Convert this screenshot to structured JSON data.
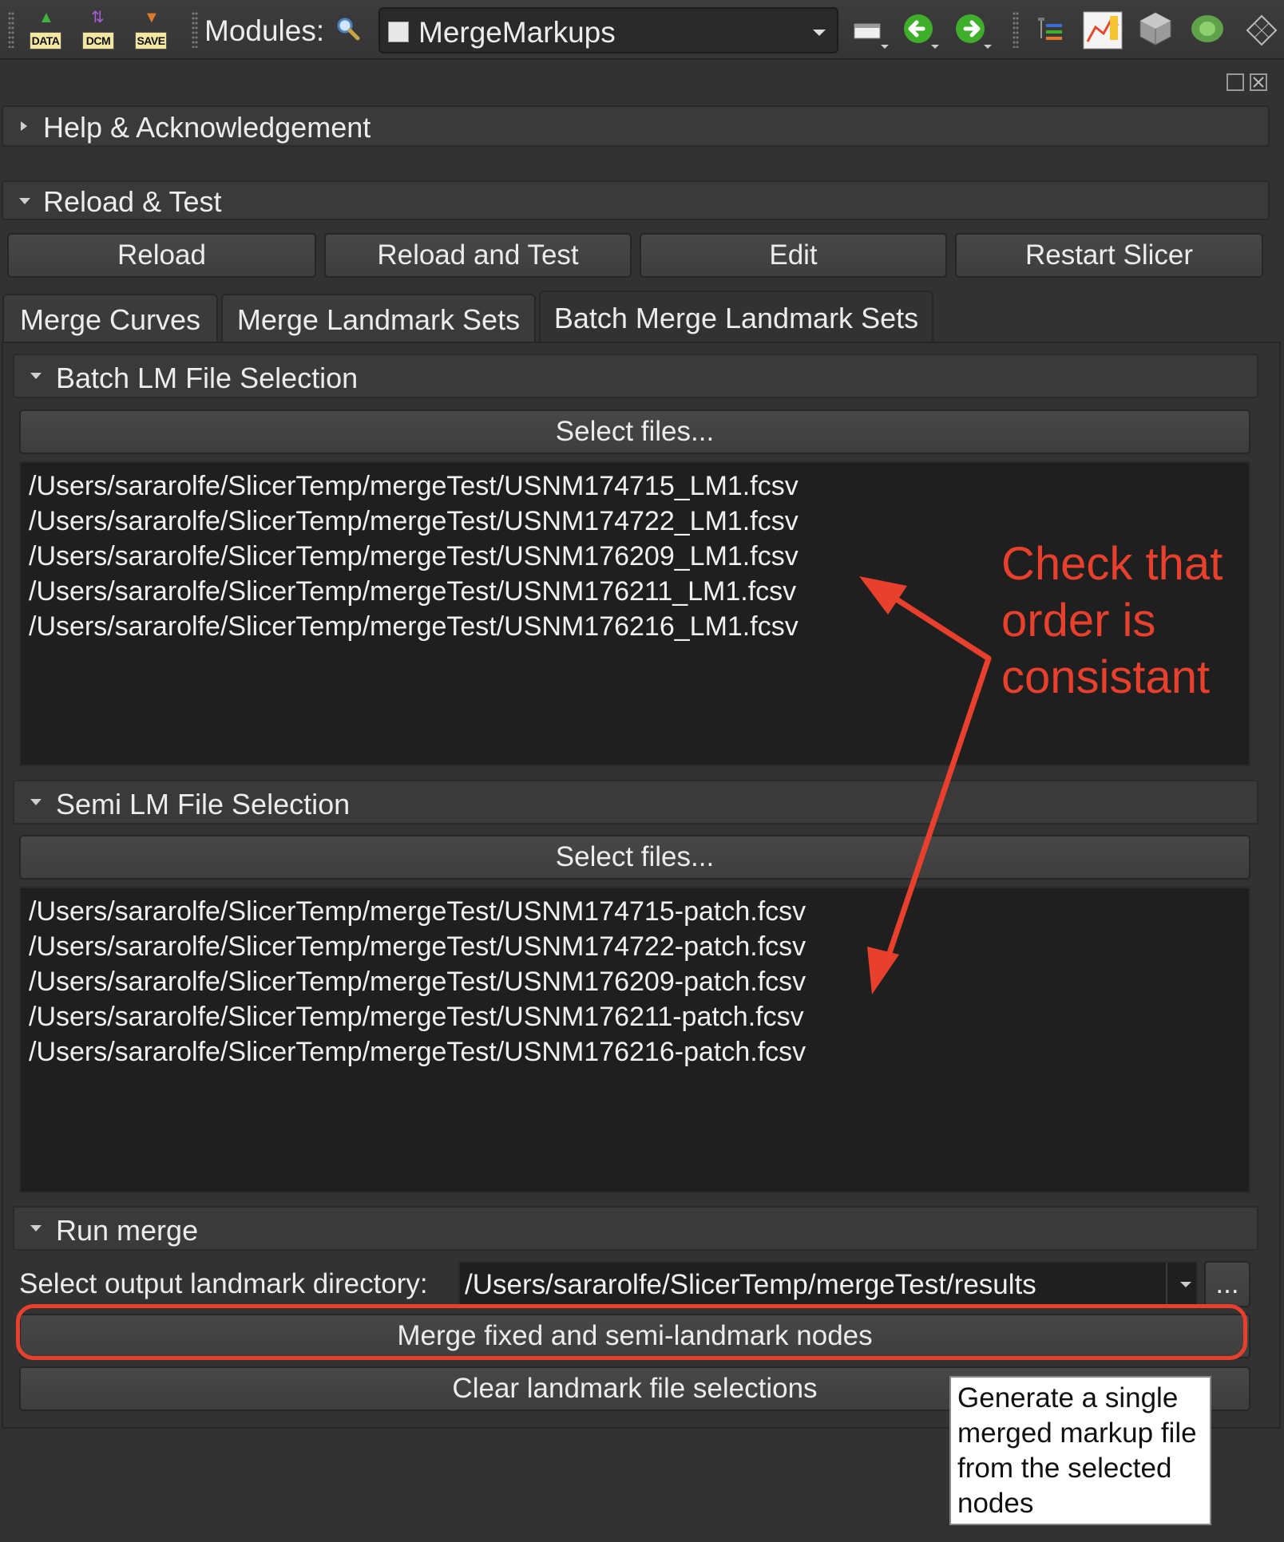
{
  "toolbar": {
    "data_label": "DATA",
    "dcm_label": "DCM",
    "save_label": "SAVE",
    "modules_label": "Modules:",
    "module_selected": "MergeMarkups"
  },
  "sections": {
    "help_title": "Help & Acknowledgement",
    "reload_title": "Reload & Test"
  },
  "reload_buttons": {
    "reload": "Reload",
    "reload_and_test": "Reload and Test",
    "edit": "Edit",
    "restart": "Restart Slicer"
  },
  "tabs": {
    "merge_curves": "Merge Curves",
    "merge_landmark_sets": "Merge Landmark Sets",
    "batch_merge": "Batch Merge Landmark Sets"
  },
  "batch_lm": {
    "title": "Batch LM File Selection",
    "select_button": "Select files...",
    "files": [
      "/Users/sararolfe/SlicerTemp/mergeTest/USNM174715_LM1.fcsv",
      "/Users/sararolfe/SlicerTemp/mergeTest/USNM174722_LM1.fcsv",
      "/Users/sararolfe/SlicerTemp/mergeTest/USNM176209_LM1.fcsv",
      "/Users/sararolfe/SlicerTemp/mergeTest/USNM176211_LM1.fcsv",
      "/Users/sararolfe/SlicerTemp/mergeTest/USNM176216_LM1.fcsv"
    ]
  },
  "semi_lm": {
    "title": "Semi LM File Selection",
    "select_button": "Select files...",
    "files": [
      "/Users/sararolfe/SlicerTemp/mergeTest/USNM174715-patch.fcsv",
      "/Users/sararolfe/SlicerTemp/mergeTest/USNM174722-patch.fcsv",
      "/Users/sararolfe/SlicerTemp/mergeTest/USNM176209-patch.fcsv",
      "/Users/sararolfe/SlicerTemp/mergeTest/USNM176211-patch.fcsv",
      "/Users/sararolfe/SlicerTemp/mergeTest/USNM176216-patch.fcsv"
    ]
  },
  "run_merge": {
    "title": "Run merge",
    "output_label": "Select output landmark directory:",
    "output_value": "/Users/sararolfe/SlicerTemp/mergeTest/results",
    "browse_label": "...",
    "merge_button": "Merge fixed and semi-landmark nodes",
    "clear_button": "Clear landmark file selections"
  },
  "annotation": {
    "line1": "Check that",
    "line2": "order is",
    "line3": "consistant",
    "color": "#e8402d"
  },
  "tooltip": {
    "line1": "Generate a single",
    "line2": "merged markup file",
    "line3": "from the selected",
    "line4": "nodes"
  }
}
